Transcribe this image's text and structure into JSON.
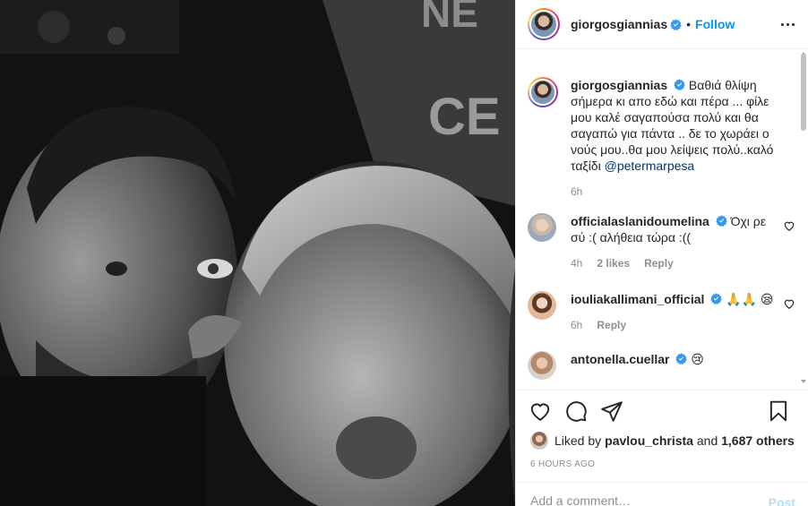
{
  "post": {
    "author": "giorgosgiannias",
    "follow_label": "Follow",
    "dot": "•",
    "caption": "Βαθιά θλίψη σήμερα κι απο εδώ και πέρα ... φίλε μου καλέ σαγαπούσα πολύ και θα σαγαπώ για πάντα .. δε το χωράει ο νούς μου..θα μου λείψεις πολύ..καλό ταξίδι ",
    "caption_mention": "@petermarpesa",
    "caption_time": "6h",
    "liked_by_prefix": "Liked by ",
    "liked_by_user": "pavlou_christa",
    "liked_by_and": " and ",
    "liked_by_others": "1,687 others",
    "time_ago": "6 HOURS AGO",
    "add_comment_placeholder": "Add a comment…",
    "post_label": "Post"
  },
  "comments": [
    {
      "user": "officialaslanidoumelina",
      "text": "Όχι ρε σύ :( αλήθεια τώρα :((",
      "time": "4h",
      "likes": "2 likes",
      "reply": "Reply"
    },
    {
      "user": "iouliakallimani_official",
      "text": "🙏🙏 😪",
      "time": "6h",
      "reply": "Reply"
    },
    {
      "user": "antonella.cuellar",
      "text": "😢"
    }
  ],
  "icons": {
    "verified": "verified-badge-icon",
    "more": "more-options-icon",
    "like": "heart-icon",
    "comment": "comment-icon",
    "share": "share-icon",
    "save": "bookmark-icon"
  },
  "colors": {
    "accent": "#0095f6",
    "verified": "#3897f0",
    "muted": "#8e8e8e",
    "post_disabled": "#b2dffc"
  }
}
